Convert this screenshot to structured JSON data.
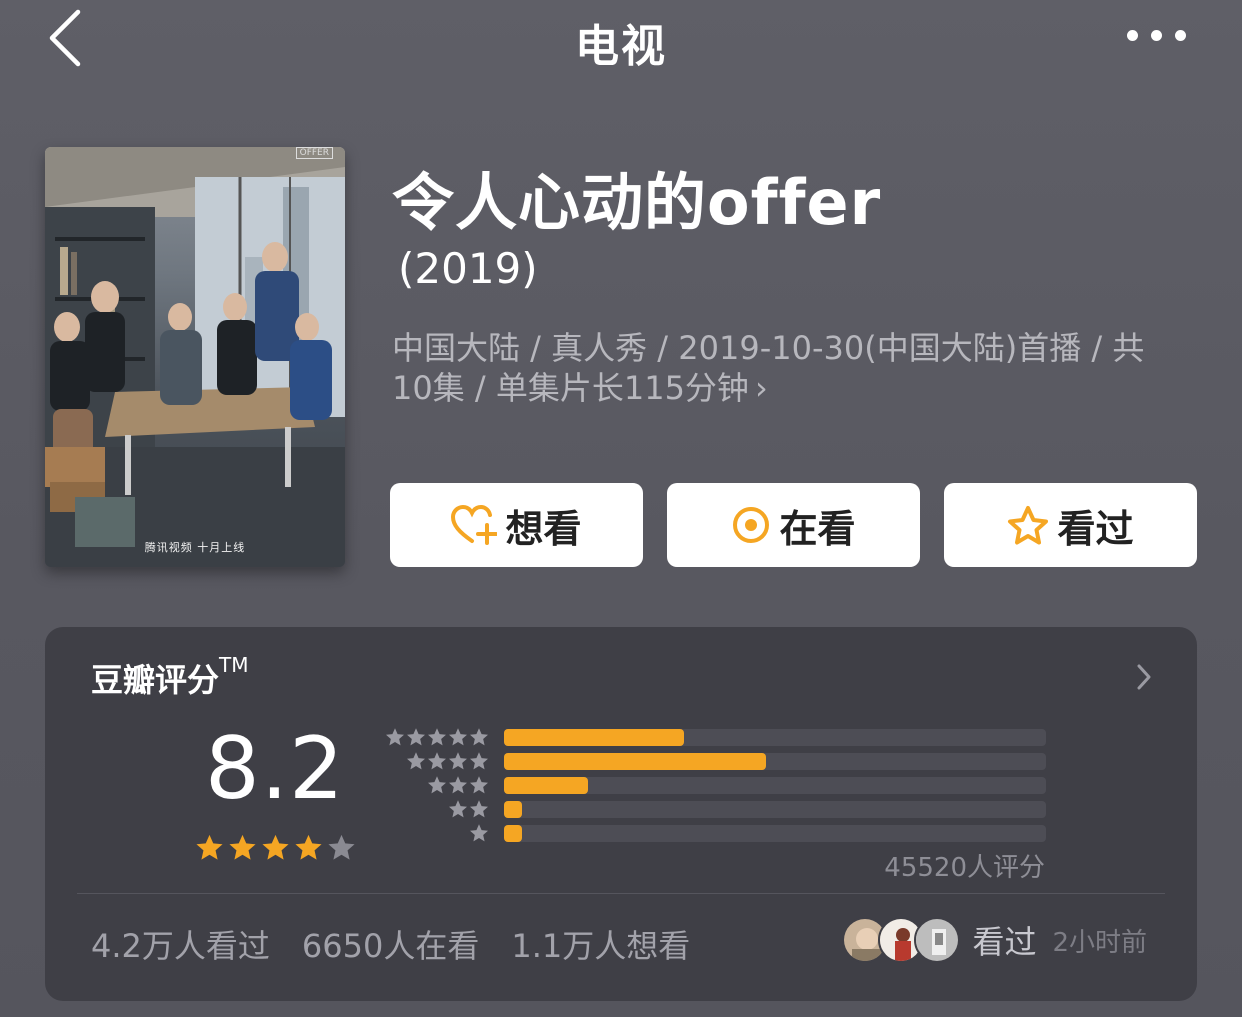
{
  "nav": {
    "title": "电视",
    "back_icon": "chevron-left-icon",
    "more_icon": "more-dots-icon"
  },
  "poster": {
    "caption": "腾讯视频 十月上线",
    "logo": "OFFER"
  },
  "subject": {
    "title": "令人心动的offer",
    "year": "(2019)",
    "meta": "中国大陆 / 真人秀 / 2019-10-30(中国大陆)首播 / 共10集 / 单集片长115分钟",
    "meta_chevron": "›"
  },
  "actions": {
    "want": {
      "label": "想看",
      "icon": "heart-plus-icon"
    },
    "watching": {
      "label": "在看",
      "icon": "target-icon"
    },
    "watched": {
      "label": "看过",
      "icon": "star-outline-icon"
    },
    "accent": "#f5a623"
  },
  "rating": {
    "title": "豆瓣评分",
    "trademark": "TM",
    "score": "8.2",
    "star_level": 4,
    "star_max": 5,
    "count_text": "45520人评分",
    "distribution": [
      {
        "stars": 5,
        "fraction": 0.333
      },
      {
        "stars": 4,
        "fraction": 0.483
      },
      {
        "stars": 3,
        "fraction": 0.155
      },
      {
        "stars": 2,
        "fraction": 0.033
      },
      {
        "stars": 1,
        "fraction": 0.033
      }
    ],
    "bar_color": "#f5a623",
    "track_color": "#4d4d55"
  },
  "stats": {
    "watched": "4.2万人看过",
    "watching": "6650人在看",
    "want": "1.1万人想看"
  },
  "friends": {
    "label": "看过",
    "time": "2小时前",
    "avatar_count": 3
  }
}
